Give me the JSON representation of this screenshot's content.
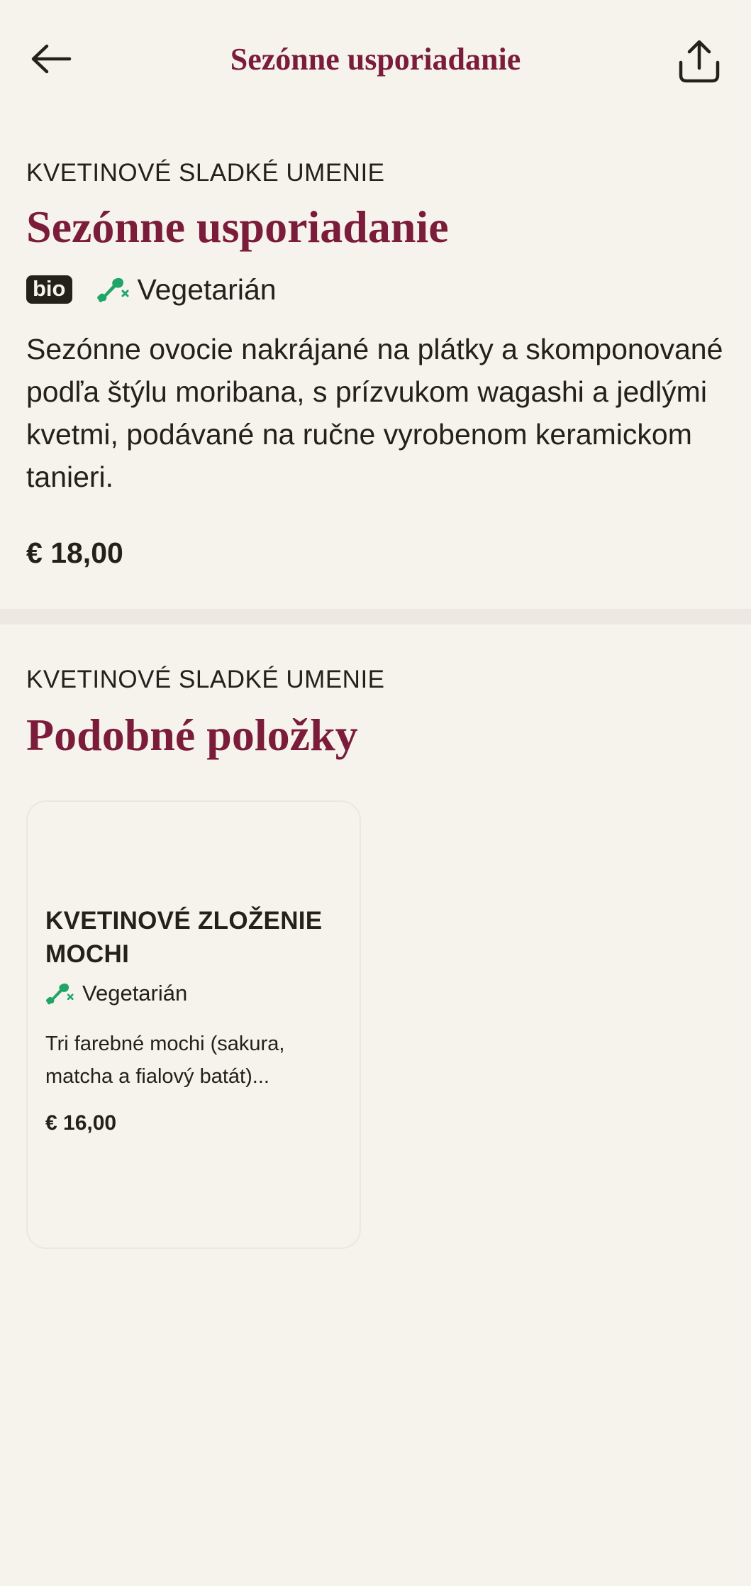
{
  "header": {
    "title": "Sezónne usporiadanie",
    "back_icon": "arrow-left-icon",
    "share_icon": "share-icon"
  },
  "item": {
    "category": "KVETINOVÉ SLADKÉ UMENIE",
    "title": "Sezónne usporiadanie",
    "badge_bio": "bio",
    "diet_label": "Vegetarián",
    "description": "Sezónne ovocie nakrájané na plátky a skomponované podľa štýlu moribana, s prízvukom wagashi a jedlými kvetmi, podávané na ručne vyrobenom keramickom tanieri.",
    "price": "€ 18,00"
  },
  "similar": {
    "category": "KVETINOVÉ SLADKÉ UMENIE",
    "title": "Podobné položky",
    "items": [
      {
        "title": "KVETINOVÉ ZLOŽENIE MOCHI",
        "diet_label": "Vegetarián",
        "description": "Tri farebné mochi (sakura, matcha a fialový batát)...",
        "price": "€ 16,00"
      }
    ]
  },
  "colors": {
    "background": "#f6f2ec",
    "accent": "#7a1c3a",
    "text": "#24201a",
    "veg_green": "#1fa567",
    "divider": "#ede8e1"
  }
}
